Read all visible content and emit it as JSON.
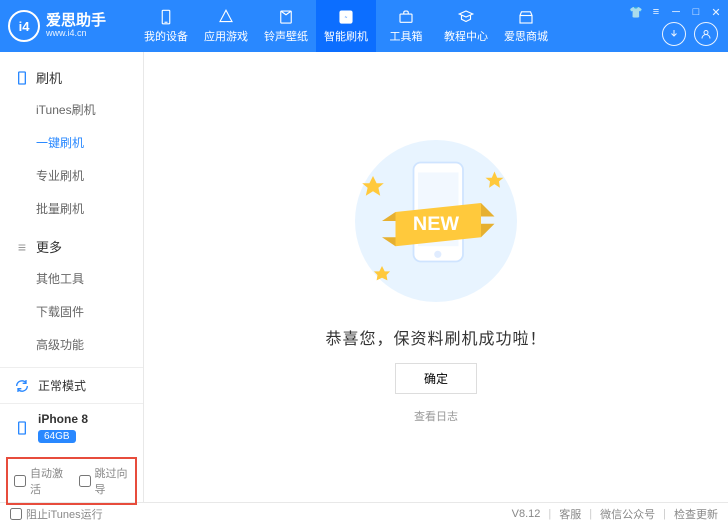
{
  "brand": {
    "zh": "爱思助手",
    "en": "www.i4.cn",
    "logo_text": "i4"
  },
  "tabs": [
    {
      "label": "我的设备"
    },
    {
      "label": "应用游戏"
    },
    {
      "label": "铃声壁纸"
    },
    {
      "label": "智能刷机"
    },
    {
      "label": "工具箱"
    },
    {
      "label": "教程中心"
    },
    {
      "label": "爱思商城"
    }
  ],
  "sidebar": {
    "section1": {
      "head": "刷机",
      "items": [
        "iTunes刷机",
        "一键刷机",
        "专业刷机",
        "批量刷机"
      ]
    },
    "section2": {
      "head": "更多",
      "items": [
        "其他工具",
        "下载固件",
        "高级功能"
      ]
    },
    "mode": "正常模式",
    "device": {
      "name": "iPhone 8",
      "storage": "64GB"
    },
    "options": {
      "auto_activate": "自动激活",
      "skip_wizard": "跳过向导"
    }
  },
  "content": {
    "success": "恭喜您，保资料刷机成功啦！",
    "confirm": "确定",
    "log": "查看日志"
  },
  "footer": {
    "block_itunes": "阻止iTunes运行",
    "version": "V8.12",
    "support": "客服",
    "wechat": "微信公众号",
    "update": "检查更新"
  }
}
